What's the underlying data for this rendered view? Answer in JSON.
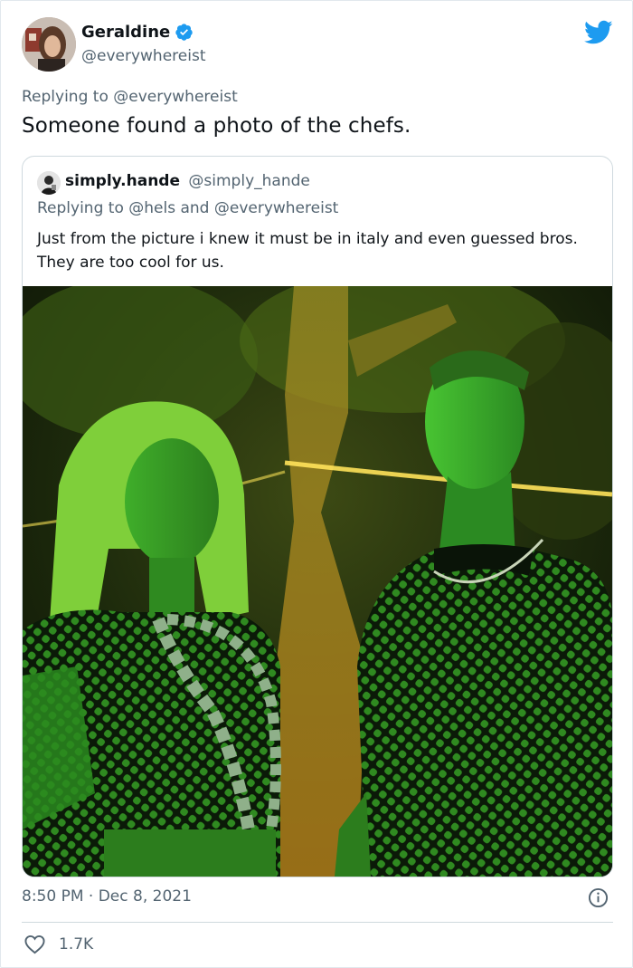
{
  "tweet": {
    "author": {
      "display_name": "Geraldine",
      "handle": "@everywhereist",
      "verified": true
    },
    "reply_prefix": "Replying to",
    "reply_mention": "@everywhereist",
    "text": "Someone found a photo of the chefs.",
    "time": "8:50 PM",
    "separator": "·",
    "date": "Dec 8, 2021",
    "likes": "1.7K"
  },
  "quote": {
    "author": {
      "display_name": "simply.hande",
      "handle": "@simply_hande"
    },
    "reply_prefix": "Replying to",
    "reply_mentions": "@hels and @everywhereist",
    "text": "Just from the picture i knew it must be in italy and even guessed bros. They are too cool for us."
  },
  "icons": {
    "verified": "verified-badge-icon",
    "logo": "twitter-bird-icon",
    "info": "info-icon",
    "like": "heart-icon"
  },
  "colors": {
    "twitter_blue": "#1d9bf0",
    "secondary_text": "#536471",
    "border": "#cfd9de"
  }
}
